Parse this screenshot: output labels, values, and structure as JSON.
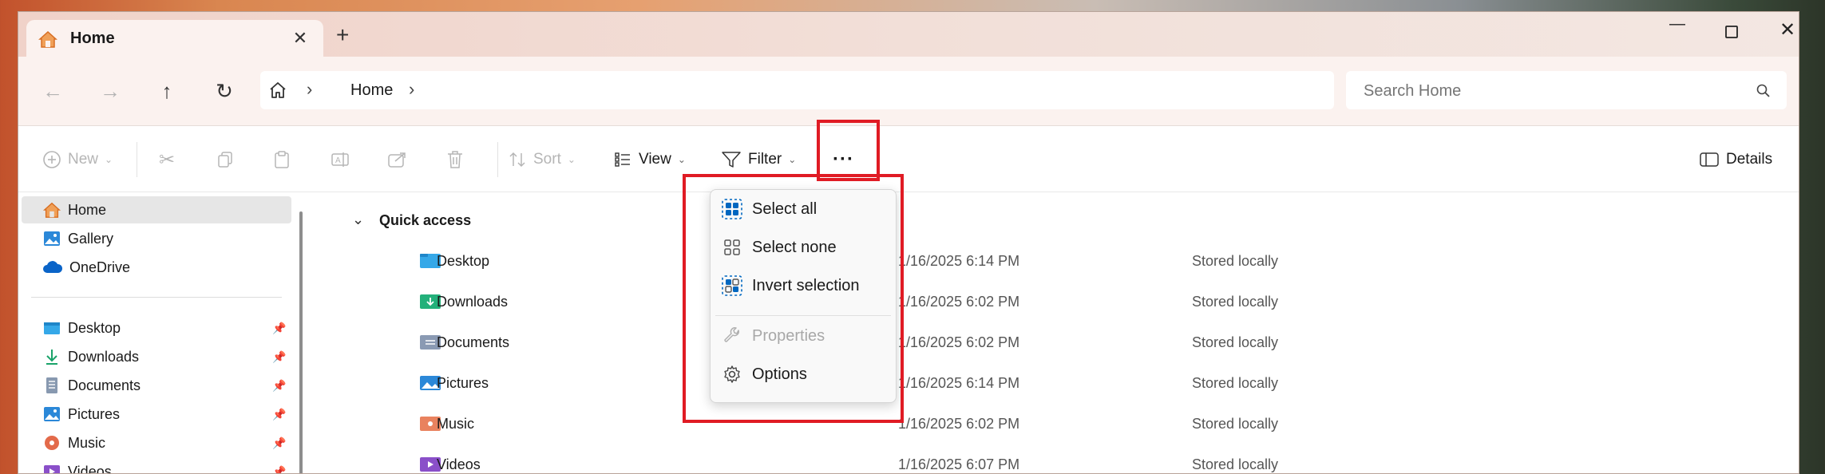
{
  "tab": {
    "title": "Home"
  },
  "titlebar": {
    "new_tab": "+"
  },
  "window_controls": {
    "minimize": "—",
    "maximize": "☐",
    "close": "✕"
  },
  "breadcrumb": {
    "item": "Home"
  },
  "search": {
    "placeholder": "Search Home"
  },
  "toolbar": {
    "new_label": "New",
    "sort_label": "Sort",
    "view_label": "View",
    "filter_label": "Filter",
    "more_label": "···",
    "details_label": "Details"
  },
  "sidebar": {
    "top": [
      {
        "label": "Home"
      },
      {
        "label": "Gallery"
      },
      {
        "label": "OneDrive"
      }
    ],
    "pinned": [
      {
        "label": "Desktop"
      },
      {
        "label": "Downloads"
      },
      {
        "label": "Documents"
      },
      {
        "label": "Pictures"
      },
      {
        "label": "Music"
      },
      {
        "label": "Videos"
      }
    ]
  },
  "main": {
    "section_title": "Quick access",
    "rows": [
      {
        "name": "Desktop",
        "date": "1/16/2025 6:14 PM",
        "status": "Stored locally"
      },
      {
        "name": "Downloads",
        "date": "1/16/2025 6:02 PM",
        "status": "Stored locally"
      },
      {
        "name": "Documents",
        "date": "1/16/2025 6:02 PM",
        "status": "Stored locally"
      },
      {
        "name": "Pictures",
        "date": "1/16/2025 6:14 PM",
        "status": "Stored locally"
      },
      {
        "name": "Music",
        "date": "1/16/2025 6:02 PM",
        "status": "Stored locally"
      },
      {
        "name": "Videos",
        "date": "1/16/2025 6:07 PM",
        "status": "Stored locally"
      }
    ]
  },
  "menu": {
    "items": [
      {
        "label": "Select all"
      },
      {
        "label": "Select none"
      },
      {
        "label": "Invert selection"
      },
      {
        "label": "Properties"
      },
      {
        "label": "Options"
      }
    ]
  },
  "colors": {
    "highlight_box": "#e01b24",
    "accent": "#0067c0"
  }
}
